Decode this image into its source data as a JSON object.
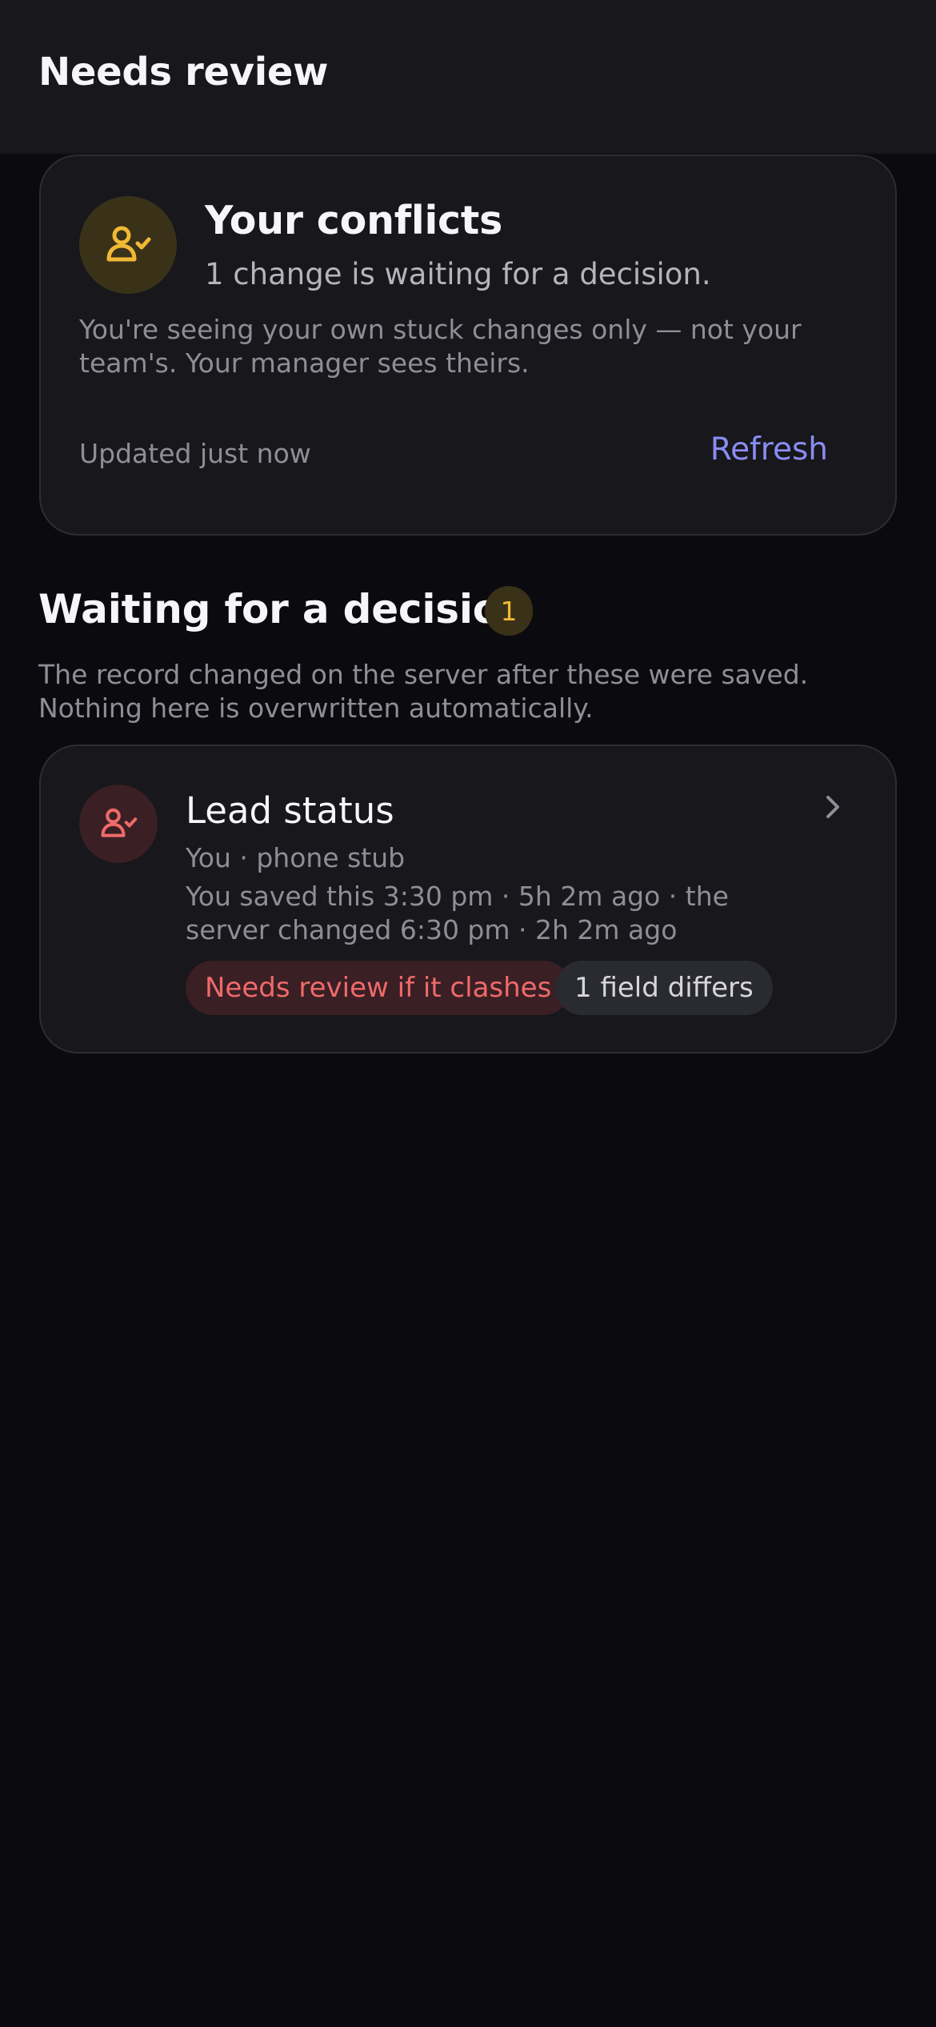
{
  "header": {
    "title": "Needs review"
  },
  "summary": {
    "icon": "user-check-icon",
    "icon_color": "#f0b935",
    "title": "Your conflicts",
    "subtitle": "1 change is waiting for a decision.",
    "note": "You're seeing your own stuck changes only — not your team's. Your manager sees theirs.",
    "updated": "Updated just now",
    "refresh_label": "Refresh",
    "accent": "#8a8cf2"
  },
  "section": {
    "title": "Waiting for a decision",
    "count": "1",
    "description": "The record changed on the server after these were saved. Nothing here is overwritten automatically."
  },
  "items": [
    {
      "icon": "user-check-icon",
      "icon_color": "#ef6a6a",
      "title": "Lead status",
      "meta": "You · phone stub",
      "times": "You saved this 3:30 pm · 5h 2m ago · the server changed 6:30 pm · 2h 2m ago",
      "chips": [
        "Needs review if it clashes",
        "1 field differs"
      ]
    }
  ]
}
